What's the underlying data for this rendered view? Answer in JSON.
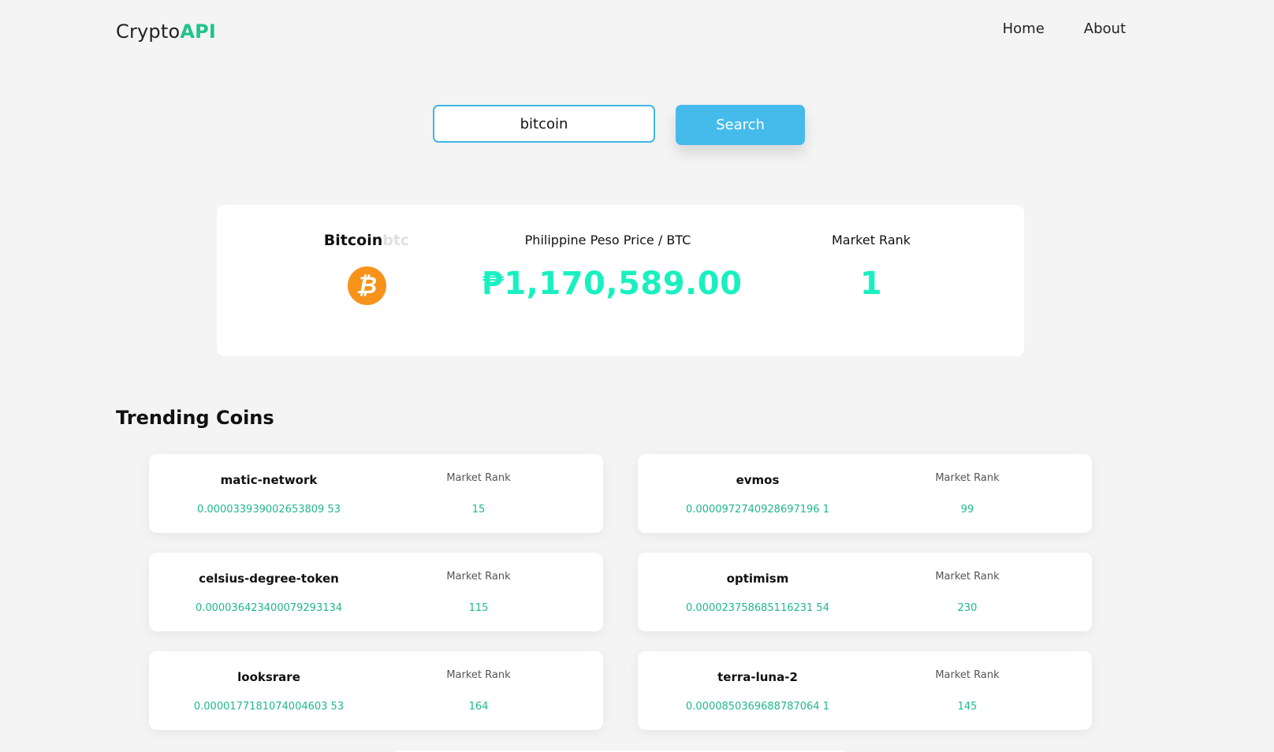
{
  "header": {
    "logo_text": "Crypto",
    "logo_accent": "API",
    "nav": [
      "Home",
      "About"
    ]
  },
  "search": {
    "value": "bitcoin",
    "button_label": "Search"
  },
  "coin": {
    "name": "Bitcoin",
    "symbol": "btc",
    "icon": "bitcoin-icon",
    "icon_glyph": "₿",
    "price_label": "Philippine Peso Price / BTC",
    "price": "₱1,170,589.00",
    "rank_label": "Market Rank",
    "rank": "1"
  },
  "trending": {
    "title": "Trending Coins",
    "rank_label": "Market Rank",
    "items": [
      {
        "name": "matic-network",
        "price": "0.000033939002653809 53",
        "rank": "15"
      },
      {
        "name": "evmos",
        "price": "0.0000972740928697196 1",
        "rank": "99"
      },
      {
        "name": "celsius-degree-token",
        "price": "0.000036423400079293134",
        "rank": "115"
      },
      {
        "name": "optimism",
        "price": "0.000023758685116231 54",
        "rank": "230"
      },
      {
        "name": "looksrare",
        "price": "0.0000177181074004603 53",
        "rank": "164"
      },
      {
        "name": "terra-luna-2",
        "price": "0.0000850369688787064 1",
        "rank": "145"
      }
    ]
  },
  "colors": {
    "accent_green": "#1fc38b",
    "price_green": "#19f0c0",
    "button_blue": "#45bbec",
    "bitcoin_orange": "#f7931a"
  }
}
